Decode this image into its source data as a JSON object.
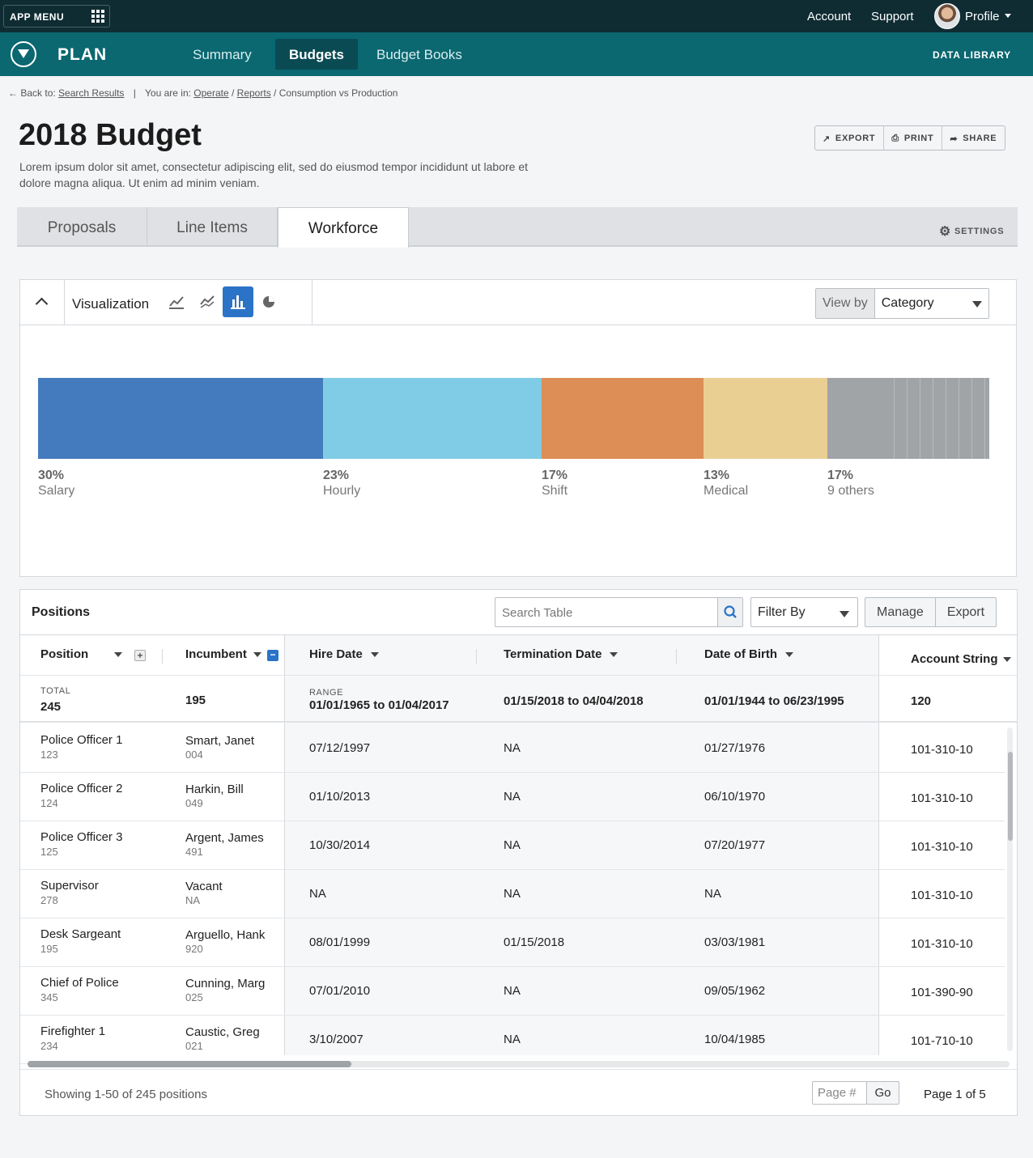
{
  "topbar": {
    "app_menu": "APP MENU",
    "account": "Account",
    "support": "Support",
    "profile": "Profile"
  },
  "nav": {
    "app_name": "PLAN",
    "tabs": [
      "Summary",
      "Budgets",
      "Budget Books"
    ],
    "active_tab": "Budgets",
    "data_library": "DATA LIBRARY"
  },
  "breadcrumb": {
    "back_prefix": "Back to:",
    "back_link": "Search Results",
    "you_are_in": "You are in:",
    "path": [
      "Operate",
      "Reports"
    ],
    "current": "Consumption vs Production"
  },
  "page": {
    "title": "2018 Budget",
    "description": "Lorem ipsum dolor sit amet, consectetur adipiscing elit, sed do eiusmod tempor incididunt ut labore et dolore magna aliqua. Ut enim ad minim veniam.",
    "actions": {
      "export": "EXPORT",
      "print": "PRINT",
      "share": "SHARE"
    }
  },
  "tabs": {
    "items": [
      "Proposals",
      "Line Items",
      "Workforce"
    ],
    "active": "Workforce",
    "settings": "SETTINGS"
  },
  "visualization": {
    "label": "Visualization",
    "view_by_label": "View by",
    "view_by_value": "Category",
    "chart_types": [
      "area-chart-icon",
      "line-chart-icon",
      "bar-chart-icon",
      "pie-chart-icon"
    ],
    "selected_chart": "bar-chart-icon"
  },
  "chart_data": {
    "type": "bar",
    "orientation": "horizontal-stacked",
    "segments": [
      {
        "pct_label": "30%",
        "name": "Salary",
        "value": 30,
        "color": "#447bbe"
      },
      {
        "pct_label": "23%",
        "name": "Hourly",
        "value": 23,
        "color": "#80cbe5"
      },
      {
        "pct_label": "17%",
        "name": "Shift",
        "value": 17,
        "color": "#dc8e56"
      },
      {
        "pct_label": "13%",
        "name": "Medical",
        "value": 13,
        "color": "#eacf93"
      },
      {
        "pct_label": "17%",
        "name": "9 others",
        "value": 17,
        "color": "#a1a4a7"
      }
    ]
  },
  "positions_table": {
    "title": "Positions",
    "search_placeholder": "Search Table",
    "filter_label": "Filter By",
    "manage": "Manage",
    "export": "Export",
    "columns": [
      "Position",
      "Incumbent",
      "Hire Date",
      "Termination Date",
      "Date of Birth",
      "Account String"
    ],
    "totals": {
      "total_label": "TOTAL",
      "total_value": "245",
      "incumbent_total": "195",
      "range_label": "RANGE",
      "hire_range": "01/01/1965 to 01/04/2017",
      "termination_range": "01/15/2018 to 04/04/2018",
      "dob_range": "01/01/1944 to 06/23/1995",
      "account_total": "120"
    },
    "rows": [
      {
        "position": "Police Officer 1",
        "position_id": "123",
        "incumbent": "Smart, Janet",
        "incumbent_id": "004",
        "hire": "07/12/1997",
        "term": "NA",
        "dob": "01/27/1976",
        "account": "101-310-10"
      },
      {
        "position": "Police Officer 2",
        "position_id": "124",
        "incumbent": "Harkin, Bill",
        "incumbent_id": "049",
        "hire": "01/10/2013",
        "term": "NA",
        "dob": "06/10/1970",
        "account": "101-310-10"
      },
      {
        "position": "Police Officer 3",
        "position_id": "125",
        "incumbent": "Argent, James",
        "incumbent_id": "491",
        "hire": "10/30/2014",
        "term": "NA",
        "dob": "07/20/1977",
        "account": "101-310-10"
      },
      {
        "position": "Supervisor",
        "position_id": "278",
        "incumbent": "Vacant",
        "incumbent_id": "NA",
        "hire": "NA",
        "term": "NA",
        "dob": "NA",
        "account": "101-310-10"
      },
      {
        "position": "Desk Sargeant",
        "position_id": "195",
        "incumbent": "Arguello, Hank",
        "incumbent_id": "920",
        "hire": "08/01/1999",
        "term": "01/15/2018",
        "dob": "03/03/1981",
        "account": "101-310-10"
      },
      {
        "position": "Chief of Police",
        "position_id": "345",
        "incumbent": "Cunning, Marg",
        "incumbent_id": "025",
        "hire": "07/01/2010",
        "term": "NA",
        "dob": "09/05/1962",
        "account": "101-390-90"
      },
      {
        "position": "Firefighter 1",
        "position_id": "234",
        "incumbent": "Caustic, Greg",
        "incumbent_id": "021",
        "hire": "3/10/2007",
        "term": "NA",
        "dob": "10/04/1985",
        "account": "101-710-10"
      }
    ],
    "footer": {
      "showing": "Showing 1-50 of 245 positions",
      "page_placeholder": "Page #",
      "go": "Go",
      "page_of": "Page 1 of 5"
    }
  }
}
